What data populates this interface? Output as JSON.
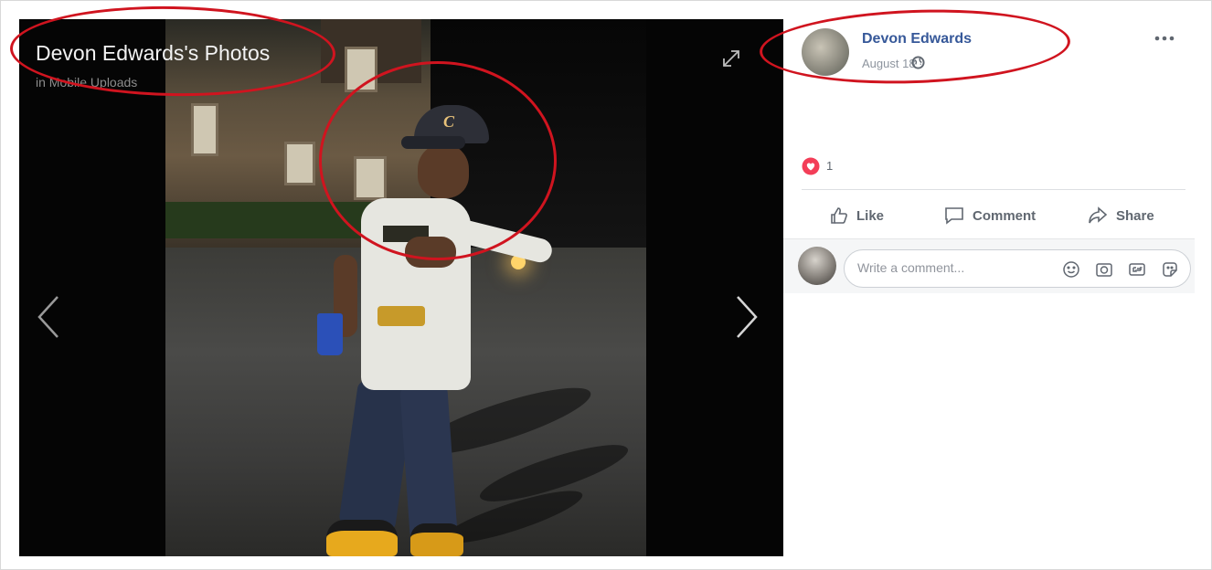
{
  "viewer": {
    "title": "Devon Edwards's Photos",
    "album": "in Mobile Uploads",
    "expand_icon": "expand-icon",
    "prev_icon": "chevron-left-icon",
    "next_icon": "chevron-right-icon"
  },
  "post": {
    "author": "Devon Edwards",
    "date": "August 18 ·",
    "privacy_icon": "globe-icon",
    "more_icon": "more-horizontal-icon"
  },
  "reactions": {
    "icon": "love-reaction-icon",
    "count": "1"
  },
  "actions": {
    "like": "Like",
    "comment": "Comment",
    "share": "Share"
  },
  "composer": {
    "placeholder": "Write a comment...",
    "icons": [
      "emoji-icon",
      "camera-icon",
      "gif-icon",
      "sticker-icon"
    ]
  },
  "colors": {
    "annotation": "#d0141f",
    "link": "#365899",
    "reaction": "#f33e58"
  }
}
